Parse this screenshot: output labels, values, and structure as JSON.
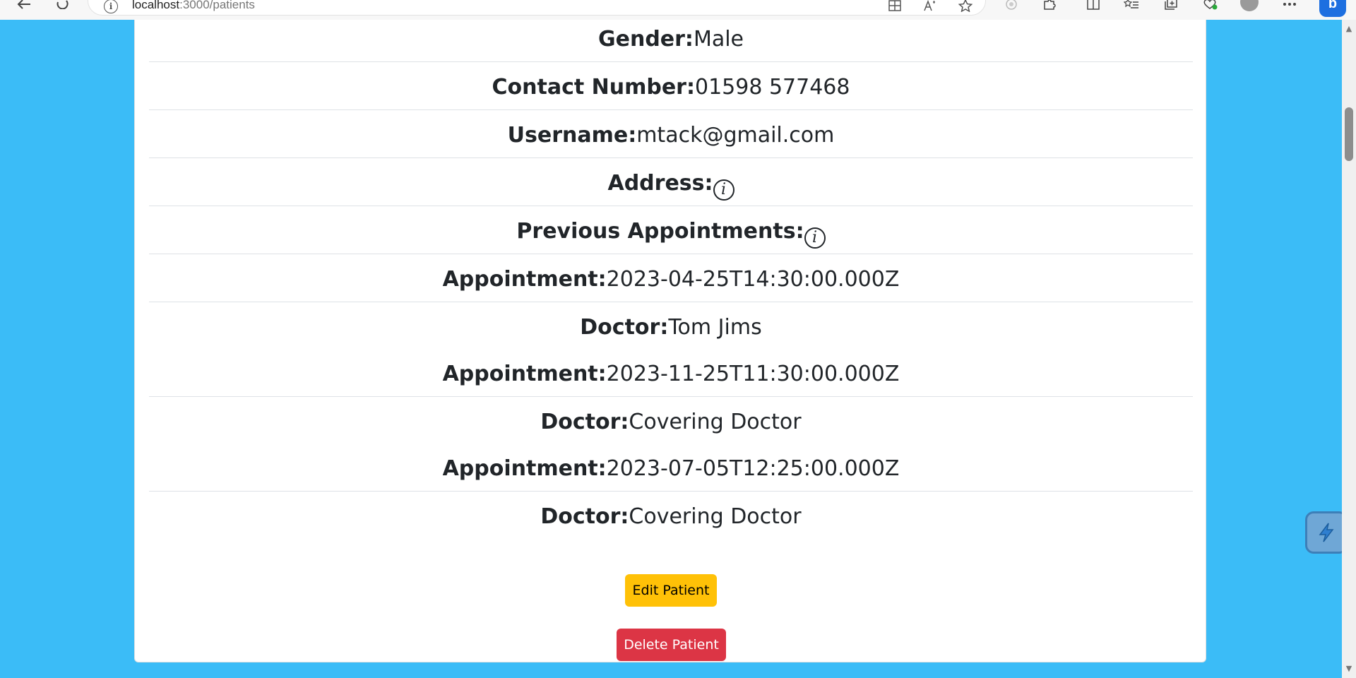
{
  "browser": {
    "address_host": "localhost",
    "address_path": ":3000/patients"
  },
  "patient": {
    "gender_label": "Gender:",
    "gender_value": "Male",
    "contact_label": "Contact Number:",
    "contact_value": "01598 577468",
    "username_label": "Username:",
    "username_value": "mtack@gmail.com",
    "address_label": "Address:",
    "previous_label": "Previous Appointments:",
    "info_glyph": "i",
    "appointments": [
      {
        "appointment_label": "Appointment:",
        "appointment_value": "2023-04-25T14:30:00.000Z",
        "doctor_label": "Doctor:",
        "doctor_value": "Tom Jims"
      },
      {
        "appointment_label": "Appointment:",
        "appointment_value": "2023-11-25T11:30:00.000Z",
        "doctor_label": "Doctor:",
        "doctor_value": "Covering Doctor"
      },
      {
        "appointment_label": "Appointment:",
        "appointment_value": "2023-07-05T12:25:00.000Z",
        "doctor_label": "Doctor:",
        "doctor_value": "Covering Doctor"
      }
    ]
  },
  "actions": {
    "edit_label": "Edit Patient",
    "delete_label": "Delete Patient"
  },
  "colors": {
    "page_background": "#3bbcf7",
    "edit_button": "#ffc107",
    "delete_button": "#dc3545"
  },
  "icons": {
    "back": "back-arrow-icon",
    "refresh": "refresh-icon",
    "site_info": "info-icon",
    "tab_grid": "grid-icon",
    "read_aloud": "read-aloud-icon",
    "favorite": "star-icon",
    "extensions": "puzzle-icon",
    "split_screen": "split-screen-icon",
    "favorites_list": "favorites-icon",
    "collections": "collections-icon",
    "browser_essentials": "heart-icon",
    "profile": "profile-icon",
    "more": "more-icon",
    "copilot": "copilot-icon",
    "widget": "extension-widget-icon"
  }
}
